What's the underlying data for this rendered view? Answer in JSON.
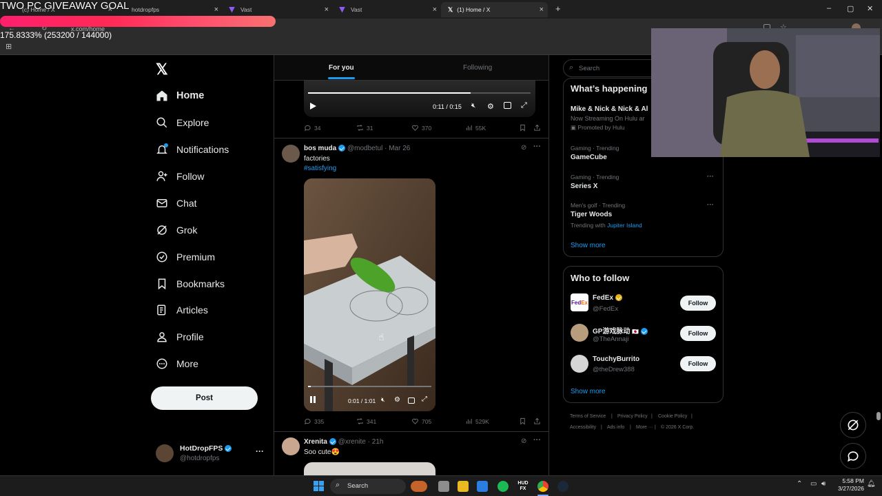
{
  "stream_overlay": {
    "goal_title": "TWO PC GIVEAWAY GOAL",
    "goal_progress_text": "175.8333% (253200 / 144000)",
    "goal_progress": 1.758333
  },
  "browser": {
    "tabs": [
      {
        "label": "(c) Home / X",
        "active": false
      },
      {
        "label": "hotdropfps",
        "active": false
      },
      {
        "label": "Vast",
        "active": false
      },
      {
        "label": "Vast",
        "active": false
      },
      {
        "label": "(1) Home / X",
        "active": true
      }
    ],
    "url": "x.com/home"
  },
  "nav": {
    "items": [
      {
        "label": "Home",
        "icon": "home-icon",
        "active": true
      },
      {
        "label": "Explore",
        "icon": "search-icon"
      },
      {
        "label": "Notifications",
        "icon": "bell-icon",
        "badge": "1"
      },
      {
        "label": "Follow",
        "icon": "person-add-icon"
      },
      {
        "label": "Chat",
        "icon": "mail-icon"
      },
      {
        "label": "Grok",
        "icon": "grok-icon"
      },
      {
        "label": "Premium",
        "icon": "premium-icon"
      },
      {
        "label": "Bookmarks",
        "icon": "bookmark-icon"
      },
      {
        "label": "Articles",
        "icon": "article-icon"
      },
      {
        "label": "Profile",
        "icon": "profile-icon"
      },
      {
        "label": "More",
        "icon": "more-circle-icon"
      }
    ],
    "post_label": "Post",
    "account": {
      "name": "HotDropFPS",
      "handle": "@hotdropfps"
    }
  },
  "feed": {
    "tabs": [
      "For you",
      "Following"
    ],
    "post1": {
      "video_time": "0:11 / 0:15",
      "video_progress": 0.73,
      "replies": "34",
      "reposts": "31",
      "likes": "370",
      "views": "55K"
    },
    "post2": {
      "name": "bos muda",
      "handle": "@modbetul",
      "date": "Mar 26",
      "text": "factories",
      "hashtag": "#satisfying",
      "video_time": "0:01 / 1:01",
      "video_progress": 0.02,
      "replies": "335",
      "reposts": "341",
      "likes": "705",
      "views": "529K"
    },
    "post3": {
      "name": "Xrenita",
      "handle": "@xrenite",
      "date": "21h",
      "text": "Soo cute😍"
    }
  },
  "sidebar": {
    "search_placeholder": "Search",
    "whats_happening": "What’s happening",
    "promo": {
      "title": "Mike & Nick & Nick & Al",
      "desc": "Now Streaming On Hulu ar",
      "promoted": "Promoted by Hulu"
    },
    "trends": [
      {
        "meta": "Gaming · Trending",
        "name": "GameCube"
      },
      {
        "meta": "Gaming · Trending",
        "name": "Series X"
      },
      {
        "meta": "Men's golf · Trending",
        "name": "Tiger Woods",
        "with_label": "Trending with",
        "with": "Jupiter Island"
      }
    ],
    "show_more": "Show more",
    "who_to_follow": "Who to follow",
    "follow_label": "Follow",
    "suggestions": [
      {
        "name": "FedEx",
        "handle": "@FedEx"
      },
      {
        "name": "GP游戏脉动",
        "handle": "@TheAnnaji"
      },
      {
        "name": "TouchyBurrito",
        "handle": "@theDrew388"
      }
    ],
    "footer": [
      "Terms of Service",
      "Privacy Policy",
      "Cookie Policy",
      "Accessibility",
      "Ads info",
      "More ···",
      "© 2026 X Corp."
    ]
  },
  "taskbar": {
    "search_label": "Search",
    "time": "5:58 PM",
    "date": "3/27/2026"
  },
  "colors": {
    "accent": "#1d9bf0",
    "overlay_bar": "#ff2a55",
    "verified_gold": "#e7b416"
  }
}
